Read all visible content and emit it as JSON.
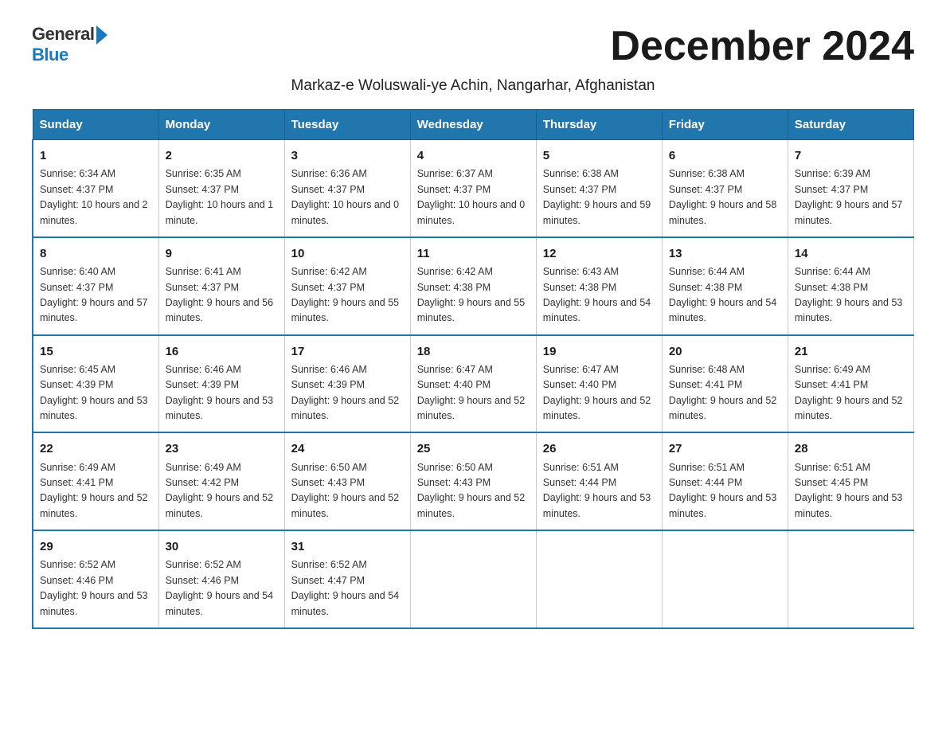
{
  "logo": {
    "text_general": "General",
    "text_blue": "Blue"
  },
  "header": {
    "month_title": "December 2024",
    "subtitle": "Markaz-e Woluswali-ye Achin, Nangarhar, Afghanistan"
  },
  "weekdays": [
    "Sunday",
    "Monday",
    "Tuesday",
    "Wednesday",
    "Thursday",
    "Friday",
    "Saturday"
  ],
  "weeks": [
    [
      {
        "day": "1",
        "sunrise": "6:34 AM",
        "sunset": "4:37 PM",
        "daylight": "10 hours and 2 minutes."
      },
      {
        "day": "2",
        "sunrise": "6:35 AM",
        "sunset": "4:37 PM",
        "daylight": "10 hours and 1 minute."
      },
      {
        "day": "3",
        "sunrise": "6:36 AM",
        "sunset": "4:37 PM",
        "daylight": "10 hours and 0 minutes."
      },
      {
        "day": "4",
        "sunrise": "6:37 AM",
        "sunset": "4:37 PM",
        "daylight": "10 hours and 0 minutes."
      },
      {
        "day": "5",
        "sunrise": "6:38 AM",
        "sunset": "4:37 PM",
        "daylight": "9 hours and 59 minutes."
      },
      {
        "day": "6",
        "sunrise": "6:38 AM",
        "sunset": "4:37 PM",
        "daylight": "9 hours and 58 minutes."
      },
      {
        "day": "7",
        "sunrise": "6:39 AM",
        "sunset": "4:37 PM",
        "daylight": "9 hours and 57 minutes."
      }
    ],
    [
      {
        "day": "8",
        "sunrise": "6:40 AM",
        "sunset": "4:37 PM",
        "daylight": "9 hours and 57 minutes."
      },
      {
        "day": "9",
        "sunrise": "6:41 AM",
        "sunset": "4:37 PM",
        "daylight": "9 hours and 56 minutes."
      },
      {
        "day": "10",
        "sunrise": "6:42 AM",
        "sunset": "4:37 PM",
        "daylight": "9 hours and 55 minutes."
      },
      {
        "day": "11",
        "sunrise": "6:42 AM",
        "sunset": "4:38 PM",
        "daylight": "9 hours and 55 minutes."
      },
      {
        "day": "12",
        "sunrise": "6:43 AM",
        "sunset": "4:38 PM",
        "daylight": "9 hours and 54 minutes."
      },
      {
        "day": "13",
        "sunrise": "6:44 AM",
        "sunset": "4:38 PM",
        "daylight": "9 hours and 54 minutes."
      },
      {
        "day": "14",
        "sunrise": "6:44 AM",
        "sunset": "4:38 PM",
        "daylight": "9 hours and 53 minutes."
      }
    ],
    [
      {
        "day": "15",
        "sunrise": "6:45 AM",
        "sunset": "4:39 PM",
        "daylight": "9 hours and 53 minutes."
      },
      {
        "day": "16",
        "sunrise": "6:46 AM",
        "sunset": "4:39 PM",
        "daylight": "9 hours and 53 minutes."
      },
      {
        "day": "17",
        "sunrise": "6:46 AM",
        "sunset": "4:39 PM",
        "daylight": "9 hours and 52 minutes."
      },
      {
        "day": "18",
        "sunrise": "6:47 AM",
        "sunset": "4:40 PM",
        "daylight": "9 hours and 52 minutes."
      },
      {
        "day": "19",
        "sunrise": "6:47 AM",
        "sunset": "4:40 PM",
        "daylight": "9 hours and 52 minutes."
      },
      {
        "day": "20",
        "sunrise": "6:48 AM",
        "sunset": "4:41 PM",
        "daylight": "9 hours and 52 minutes."
      },
      {
        "day": "21",
        "sunrise": "6:49 AM",
        "sunset": "4:41 PM",
        "daylight": "9 hours and 52 minutes."
      }
    ],
    [
      {
        "day": "22",
        "sunrise": "6:49 AM",
        "sunset": "4:41 PM",
        "daylight": "9 hours and 52 minutes."
      },
      {
        "day": "23",
        "sunrise": "6:49 AM",
        "sunset": "4:42 PM",
        "daylight": "9 hours and 52 minutes."
      },
      {
        "day": "24",
        "sunrise": "6:50 AM",
        "sunset": "4:43 PM",
        "daylight": "9 hours and 52 minutes."
      },
      {
        "day": "25",
        "sunrise": "6:50 AM",
        "sunset": "4:43 PM",
        "daylight": "9 hours and 52 minutes."
      },
      {
        "day": "26",
        "sunrise": "6:51 AM",
        "sunset": "4:44 PM",
        "daylight": "9 hours and 53 minutes."
      },
      {
        "day": "27",
        "sunrise": "6:51 AM",
        "sunset": "4:44 PM",
        "daylight": "9 hours and 53 minutes."
      },
      {
        "day": "28",
        "sunrise": "6:51 AM",
        "sunset": "4:45 PM",
        "daylight": "9 hours and 53 minutes."
      }
    ],
    [
      {
        "day": "29",
        "sunrise": "6:52 AM",
        "sunset": "4:46 PM",
        "daylight": "9 hours and 53 minutes."
      },
      {
        "day": "30",
        "sunrise": "6:52 AM",
        "sunset": "4:46 PM",
        "daylight": "9 hours and 54 minutes."
      },
      {
        "day": "31",
        "sunrise": "6:52 AM",
        "sunset": "4:47 PM",
        "daylight": "9 hours and 54 minutes."
      },
      null,
      null,
      null,
      null
    ]
  ],
  "labels": {
    "sunrise": "Sunrise:",
    "sunset": "Sunset:",
    "daylight": "Daylight:"
  }
}
